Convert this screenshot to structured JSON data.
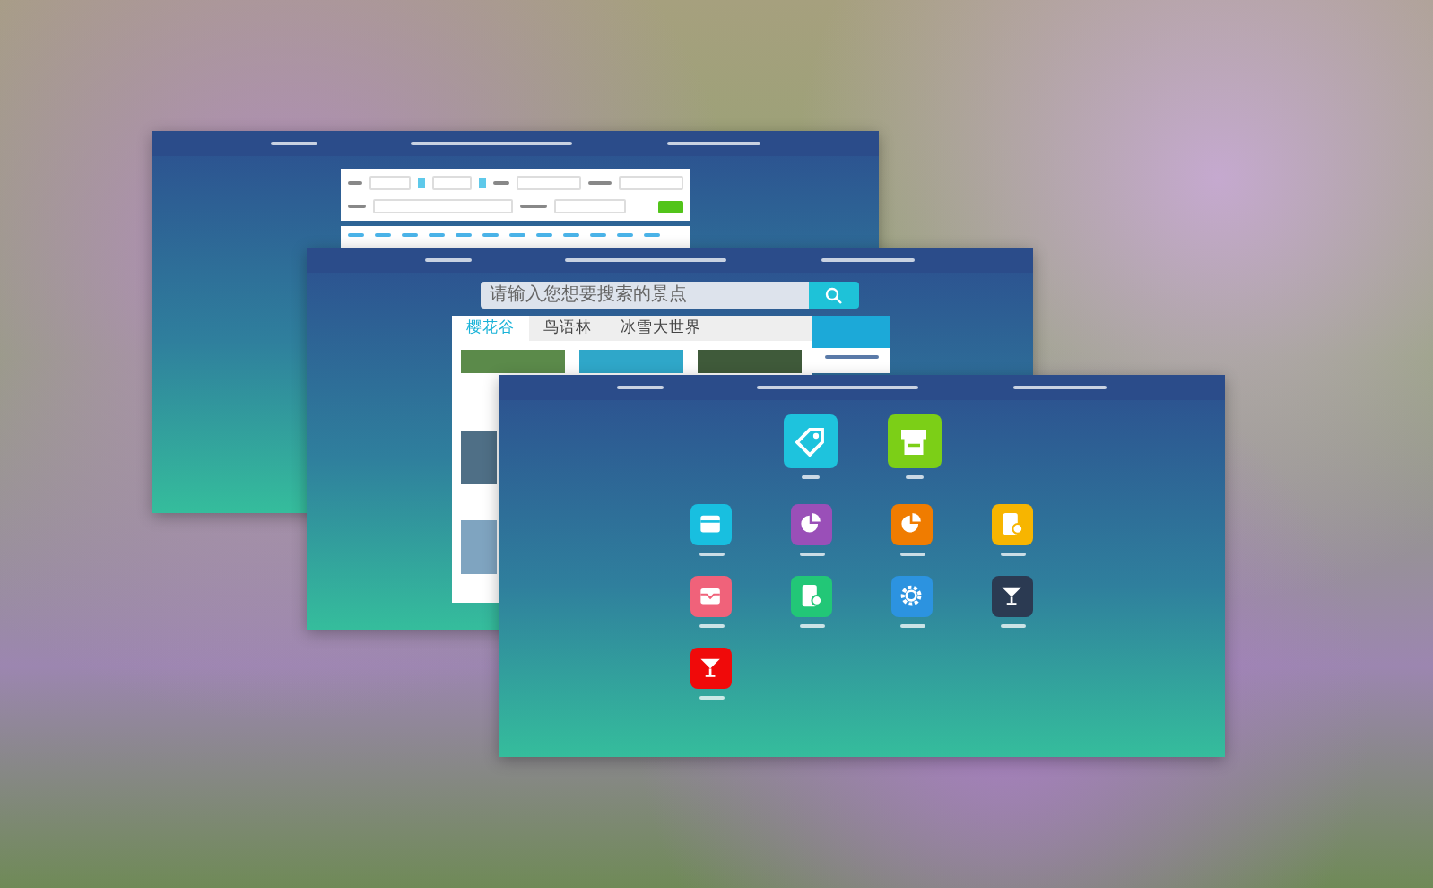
{
  "windows": [
    {
      "kind": "query-form"
    },
    {
      "kind": "portal",
      "search": {
        "placeholder": "请输入您想要搜索的景点"
      },
      "tabs": [
        {
          "label": "樱花谷",
          "selected": true
        },
        {
          "label": "鸟语林",
          "selected": false
        },
        {
          "label": "冰雪大世界",
          "selected": false
        }
      ],
      "photos": [
        {
          "color": "#5b8a4a"
        },
        {
          "color": "#2fa7c9"
        },
        {
          "color": "#3f5a3a"
        },
        {
          "color": "#4f6f86"
        },
        {
          "color": "#7fa4c0"
        }
      ]
    },
    {
      "kind": "launcher",
      "apps": [
        {
          "kind": "large",
          "color": "#1ec3dd"
        },
        {
          "kind": "large",
          "color": "#7ccf17"
        },
        {
          "kind": "small",
          "color": "#18bfe0"
        },
        {
          "kind": "small",
          "color": "#9a4fb8"
        },
        {
          "kind": "small",
          "color": "#f07c00"
        },
        {
          "kind": "small",
          "color": "#f7b500"
        },
        {
          "kind": "small",
          "color": "#f0627a"
        },
        {
          "kind": "small",
          "color": "#22c777"
        },
        {
          "kind": "small",
          "color": "#2c93e0"
        },
        {
          "kind": "small",
          "color": "#2b3a52"
        },
        {
          "kind": "small",
          "color": "#f00a0a"
        }
      ]
    }
  ]
}
